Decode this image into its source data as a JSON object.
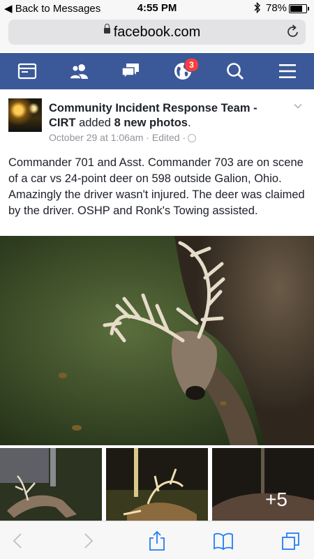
{
  "status_bar": {
    "back_label": "◀ Back to Messages",
    "time": "4:55 PM",
    "battery": "78%",
    "battery_level": 0.78
  },
  "browser": {
    "url": "facebook.com"
  },
  "fb_nav": {
    "items": [
      "news-feed-icon",
      "friends-icon",
      "messages-icon",
      "notifications-globe-icon",
      "search-icon",
      "menu-icon"
    ],
    "notification_count": "3"
  },
  "post": {
    "author": "Community Incident Response Team - CIRT",
    "action_prefix": " added ",
    "action_strong": "8 new photos",
    "action_suffix": ".",
    "date": "October 29 at 1:06am · Edited ·",
    "text": "Commander 701 and Asst. Commander 703 are on scene of a car vs 24-point deer on 598 outside Galion, Ohio. Amazingly the driver wasn't injured. The deer was claimed by the driver. OSHP and Ronk's Towing assisted.",
    "more_photos": "+5"
  },
  "toolbar": {
    "items": [
      "back-arrow-icon",
      "forward-arrow-icon",
      "share-icon",
      "bookmarks-icon",
      "tabs-icon"
    ]
  },
  "colors": {
    "fb_blue": "#3b5998",
    "badge_red": "#fa3e3e",
    "ios_blue": "#1f7ef6",
    "meta_gray": "#90949c"
  }
}
